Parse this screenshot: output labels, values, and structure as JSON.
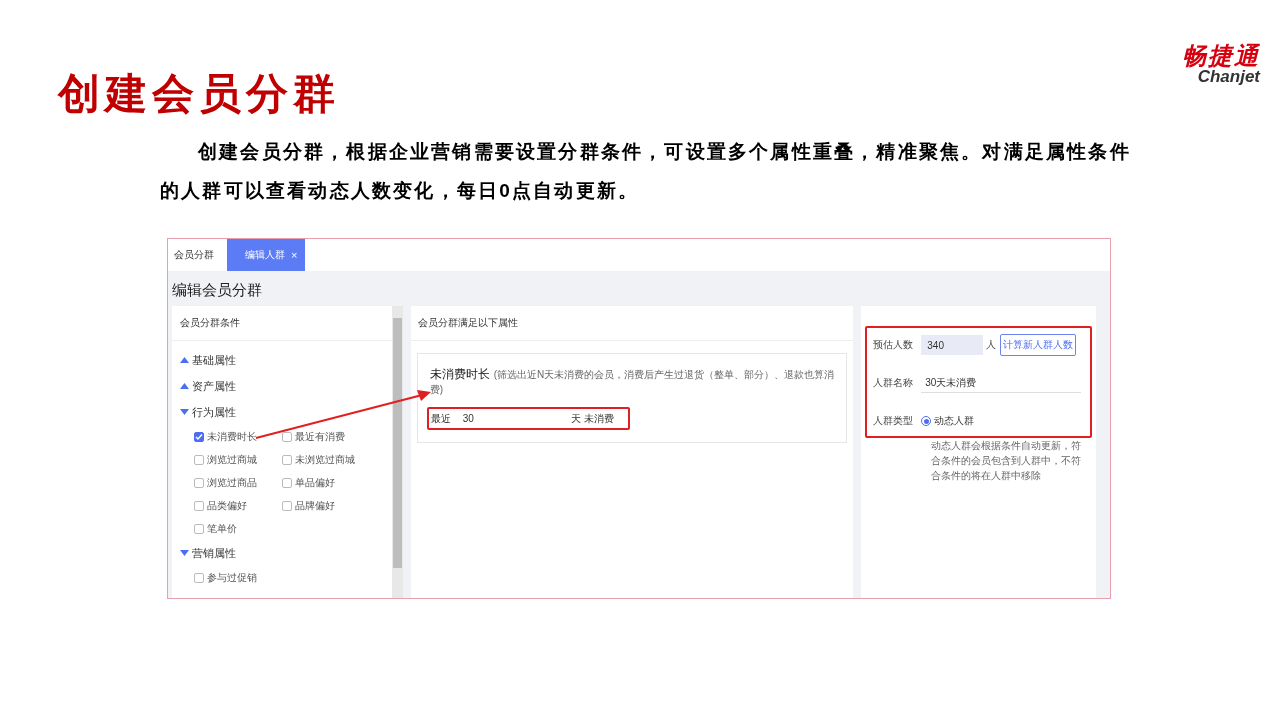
{
  "logo": {
    "name": "畅捷通",
    "subtitle": "Chanjet"
  },
  "title": "创建会员分群",
  "description": "创建会员分群，根据企业营销需要设置分群条件，可设置多个属性重叠，精准聚焦。对满足属性条件的人群可以查看动态人数变化，每日0点自动更新。",
  "screenshot": {
    "tabs": [
      {
        "label": "会员分群",
        "selected": false
      },
      {
        "label": "编辑人群",
        "selected": true,
        "close": "×"
      }
    ],
    "page_title": "编辑会员分群",
    "left_panel": {
      "title": "会员分群条件",
      "groups": [
        {
          "label": "基础属性",
          "expanded": false
        },
        {
          "label": "资产属性",
          "expanded": false
        },
        {
          "label": "行为属性",
          "expanded": true,
          "options": [
            {
              "label": "未消费时长",
              "checked": true
            },
            {
              "label": "最近有消费",
              "checked": false
            },
            {
              "label": "浏览过商城",
              "checked": false
            },
            {
              "label": "未浏览过商城",
              "checked": false
            },
            {
              "label": "浏览过商品",
              "checked": false
            },
            {
              "label": "单品偏好",
              "checked": false
            },
            {
              "label": "品类偏好",
              "checked": false
            },
            {
              "label": "品牌偏好",
              "checked": false
            },
            {
              "label": "笔单价",
              "checked": false
            }
          ]
        },
        {
          "label": "营销属性",
          "expanded": true,
          "options": [
            {
              "label": "参与过促销",
              "checked": false
            }
          ]
        }
      ]
    },
    "middle_panel": {
      "title": "会员分群满足以下属性",
      "condition": {
        "name": "未消费时长",
        "hint": "(筛选出近N天未消费的会员，消费后产生过退货（整单、部分）、退款也算消费)",
        "prefix": "最近",
        "value": "30",
        "suffix": "天 未消费"
      }
    },
    "right_panel": {
      "estimate": {
        "label": "预估人数",
        "value": "340",
        "unit": "人",
        "button": "计算新人群人数"
      },
      "name": {
        "label": "人群名称",
        "value": "30天未消费"
      },
      "type": {
        "label": "人群类型",
        "option": {
          "label": "动态人群",
          "selected": true
        },
        "description": "动态人群会根据条件自动更新，符合条件的会员包含到人群中，不符合条件的将在人群中移除"
      }
    }
  }
}
